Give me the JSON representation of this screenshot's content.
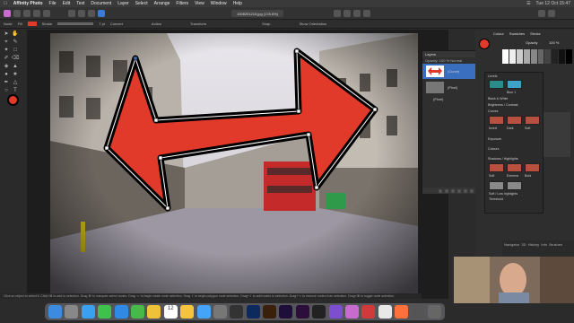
{
  "menubar": {
    "app_name": "Affinity Photo",
    "items": [
      "File",
      "Edit",
      "Text",
      "Document",
      "Layer",
      "Select",
      "Arrange",
      "Filters",
      "View",
      "Window",
      "Help"
    ],
    "clock": "Tue 12 Oct 15:47"
  },
  "toolbar": {
    "doc_title": "1008201215.jpg (178.6%)"
  },
  "context": {
    "mode_label": "Node",
    "fill_label": "Fill",
    "stroke_label": "Stroke",
    "stroke_width": "7 pt",
    "convert_label": "Convert",
    "action_label": "Action",
    "transform_label": "Transform",
    "snap_label": "Snap",
    "show_orientation": "Show Orientation"
  },
  "layers": {
    "title": "Layers",
    "opacity_label": "Opacity:",
    "opacity_value": "100 %",
    "blend": "Normal",
    "rows": [
      {
        "name": "(Curve)",
        "selected": true
      },
      {
        "name": "(Pixel)",
        "selected": false
      },
      {
        "name": "(Pixel)",
        "selected": false
      }
    ]
  },
  "right_panel": {
    "tabs": [
      "Colour",
      "Swatches",
      "Stroke"
    ],
    "opacity_label": "Opacity",
    "opacity_value": "100 %"
  },
  "adjustments": {
    "items": [
      {
        "label": "Levels",
        "thumbs": [
          "Default",
          "Blue 1"
        ]
      },
      {
        "label": "Black & White",
        "thumbs": []
      },
      {
        "label": "Brightness / Contrast",
        "thumbs": []
      },
      {
        "label": "Curves",
        "thumbs": [
          "Invert",
          "Dark",
          "Soft"
        ]
      },
      {
        "label": "Exposure",
        "thumbs": []
      },
      {
        "label": "Colours",
        "thumbs": []
      },
      {
        "label": "Shadows / Highlights",
        "thumbs": [
          "Soft",
          "Extreme",
          "Bold"
        ]
      },
      {
        "label": "Threshold",
        "thumbs": [
          "Soft / Low highlights",
          "Deep / Bright"
        ]
      }
    ]
  },
  "navigator": {
    "tabs": [
      "Navigator",
      "3D",
      "History",
      "Info",
      "Brushes"
    ]
  },
  "status": {
    "text": "Click an object to select it. Click+⌘ to add to selection. Drag ⌘ to marquee select nodes. Drag ⌥ to begin rotate node selection. Drag ⇧ to begin polygon node selection. Drag+⇧ to add nodes to selection. Drag+⌥ to remove nodes from selection. Drag+⌘ to toggle node selection."
  },
  "dock": {
    "calendar_day": "12",
    "calendar_month": "OCT"
  },
  "colors": {
    "arrow_fill": "#e23a2a",
    "arrow_stroke": "#000000",
    "selection": "#3a6fbf",
    "accent": "#c86bd0"
  }
}
